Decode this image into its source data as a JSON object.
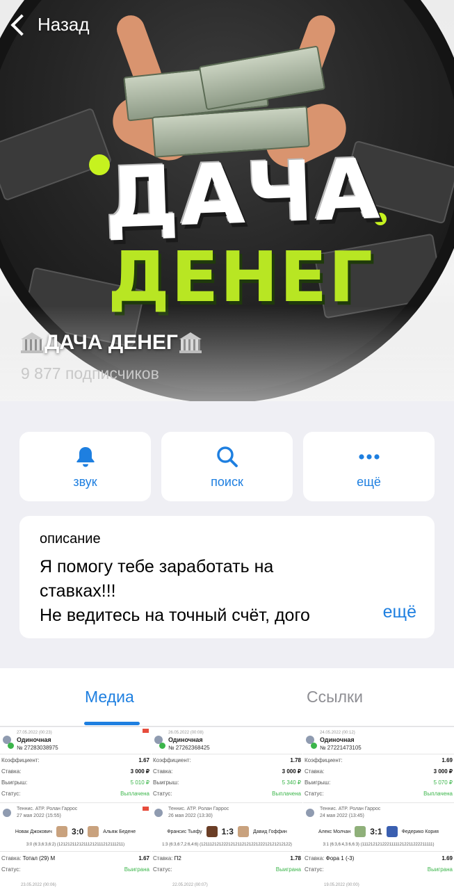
{
  "header": {
    "back_label": "Назад",
    "channel_title": "ДАЧА ДЕНЕГ",
    "subscribers": "9 877 подписчиков",
    "logo_text": {
      "line1": "ДАЧА",
      "line2": "ДЕНЕГ"
    }
  },
  "actions": [
    {
      "label": "звук",
      "icon": "bell-icon"
    },
    {
      "label": "поиск",
      "icon": "search-icon"
    },
    {
      "label": "ещё",
      "icon": "more-icon"
    }
  ],
  "description": {
    "header": "описание",
    "line1": "Я помогу тебе заработать на",
    "line2": "ставках!!!",
    "line3": "Не ведитесь на точный счёт, дого",
    "more": "ещё"
  },
  "tabs": [
    {
      "label": "Медиа",
      "active": true
    },
    {
      "label": "Ссылки",
      "active": false
    }
  ],
  "colors": {
    "accent": "#1e7fe0",
    "brand_green": "#b8e623",
    "win_green": "#3bb54a"
  },
  "media": [
    {
      "date": "27.05.2022 (00:23)",
      "type": "Одиночная",
      "num": "№ 27283038975",
      "coef_label": "Коэффициент:",
      "coef": "1.67",
      "stake_label": "Ставка:",
      "stake": "3 000 ₽",
      "win_label": "Выигрыш:",
      "win": "5 010 ₽",
      "status_label": "Статус:",
      "status": "Выплачена",
      "event": "Теннис. ATP. Ролан Гаррос",
      "event_date": "27 мая 2022 (15:55)",
      "p1": "Новак Джокович",
      "score": "3:0",
      "p2": "Альяж Бедене",
      "sets": "3:0 (6:3,6:3,6:2) (12121211212111212111212111211)",
      "bet_label": "Ставка:",
      "bet": "Тотал (29) М",
      "bet_coef": "1.67",
      "status2": "Выиграна",
      "next_date": "23.05.2022 (00:06)"
    },
    {
      "date": "26.05.2022 (00:08)",
      "type": "Одиночная",
      "num": "№ 27262368425",
      "coef_label": "Коэффициент:",
      "coef": "1.78",
      "stake_label": "Ставка:",
      "stake": "3 000 ₽",
      "win_label": "Выигрыш:",
      "win": "5 340 ₽",
      "status_label": "Статус:",
      "status": "Выплачена",
      "event": "Теннис. ATP. Ролан Гаррос",
      "event_date": "26 мая 2022 (13:30)",
      "p1": "Франсис Тьяфу",
      "score": "1:3",
      "p2": "Давид Гоффин",
      "sets": "1:3 (6:3,6:7,2:6,4:6) (121112121222121211212122122212121212122)",
      "bet_label": "Ставка:",
      "bet": "П2",
      "bet_coef": "1.78",
      "status2": "Выиграна",
      "next_date": "22.05.2022 (00:07)"
    },
    {
      "date": "24.05.2022 (00:12)",
      "type": "Одиночная",
      "num": "№ 27221473105",
      "coef_label": "Коэффициент:",
      "coef": "1.69",
      "stake_label": "Ставка:",
      "stake": "3 000 ₽",
      "win_label": "Выигрыш:",
      "win": "5 070 ₽",
      "status_label": "Статус:",
      "status": "Выплачена",
      "event": "Теннис. ATP. Ролан Гаррос",
      "event_date": "24 мая 2022 (13:45)",
      "p1": "Алекс Молчан",
      "score": "3:1",
      "p2": "Федерико Кория",
      "sets": "3:1 (6:3,6:4,3:6,6:3) (11121212122211111212211222211111)",
      "bet_label": "Ставка:",
      "bet": "Фора 1 (-3)",
      "bet_coef": "1.69",
      "status2": "Выиграна",
      "next_date": "19.05.2022 (00:00)"
    }
  ]
}
